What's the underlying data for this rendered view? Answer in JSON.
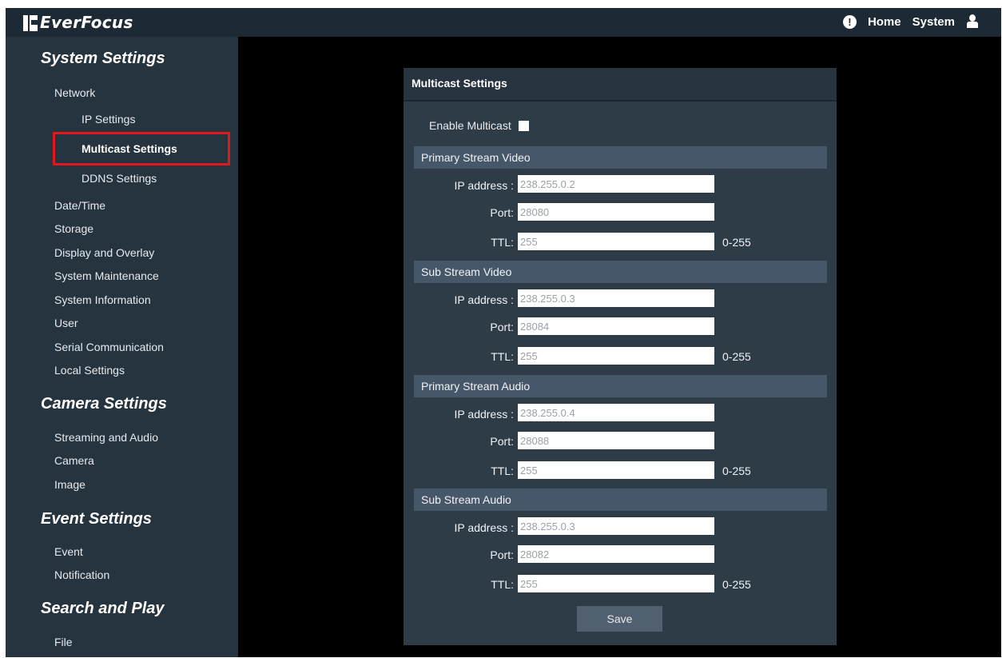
{
  "header": {
    "logo_text": "EverFocus",
    "nav": {
      "home": "Home",
      "system": "System"
    }
  },
  "sidebar": {
    "sections": [
      {
        "title": "System Settings",
        "items": [
          "Network",
          "IP Settings",
          "Multicast Settings",
          "DDNS Settings",
          "Date/Time",
          "Storage",
          "Display and Overlay",
          "System Maintenance",
          "System Information",
          "User",
          "Serial Communication",
          "Local Settings"
        ]
      },
      {
        "title": "Camera Settings",
        "items": [
          "Streaming and Audio",
          "Camera",
          "Image"
        ]
      },
      {
        "title": "Event Settings",
        "items": [
          "Event",
          "Notification"
        ]
      },
      {
        "title": "Search and Play",
        "items": [
          "File"
        ]
      }
    ],
    "active_item": "Multicast Settings"
  },
  "panel": {
    "title": "Multicast Settings",
    "enable_label": "Enable Multicast",
    "enable_checked": false,
    "labels": {
      "ip": "IP address :",
      "port": "Port:",
      "ttl": "TTL:",
      "range": "0-255"
    },
    "streams": [
      {
        "name": "Primary Stream Video",
        "ip": "238.255.0.2",
        "port": "28080",
        "ttl": "255"
      },
      {
        "name": "Sub Stream Video",
        "ip": "238.255.0.3",
        "port": "28084",
        "ttl": "255"
      },
      {
        "name": "Primary Stream Audio",
        "ip": "238.255.0.4",
        "port": "28088",
        "ttl": "255"
      },
      {
        "name": "Sub Stream Audio",
        "ip": "238.255.0.3",
        "port": "28082",
        "ttl": "255"
      }
    ],
    "save_label": "Save"
  }
}
